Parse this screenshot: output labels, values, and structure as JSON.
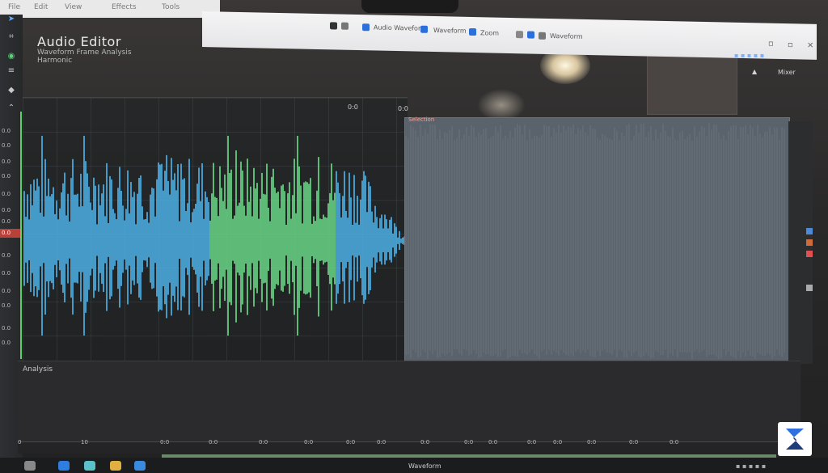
{
  "app": {
    "title": "Audio Editor",
    "subtitle": "Waveform Frame Analysis",
    "subtitle2": "Harmonic"
  },
  "menu": [
    "File",
    "Edit",
    "View",
    "Effects",
    "Tools"
  ],
  "toolbar": {
    "tab_main": "Audio Waveform",
    "tab_view": "Waveform",
    "field_zoom": "Zoom",
    "right_label": "Mixer"
  },
  "left_tools": {
    "numbers": [
      "0.0",
      "0.0",
      "0.0",
      "0.0",
      "0.0",
      "0.0",
      "0.0",
      "0.0",
      "0.0",
      "0.0",
      "0.0",
      "0.0",
      "0.0"
    ],
    "selected_value": "0.0"
  },
  "wave": {
    "marker_label": "0:0",
    "marker_label2": "0:0",
    "selection_tag": "Selection"
  },
  "bottom": {
    "label": "Analysis"
  },
  "timeline": {
    "ticks": [
      "0",
      "10",
      "0:0",
      "0:0",
      "0:0",
      "0:0",
      "0:0",
      "0:0",
      "0:0",
      "0:0",
      "0:0",
      "0:0",
      "0:0",
      "0:0",
      "0:0",
      "0:0"
    ]
  },
  "taskbar": {
    "center": "Waveform"
  },
  "colors": {
    "wave_blue": "#4fb8f0",
    "wave_green": "#6ee08c",
    "selection": "#5a626c",
    "accent_red": "#b8423a"
  },
  "icons": [
    "pointer-icon",
    "crop-icon",
    "globe-icon",
    "play-icon",
    "zoom-icon",
    "settings-icon"
  ]
}
